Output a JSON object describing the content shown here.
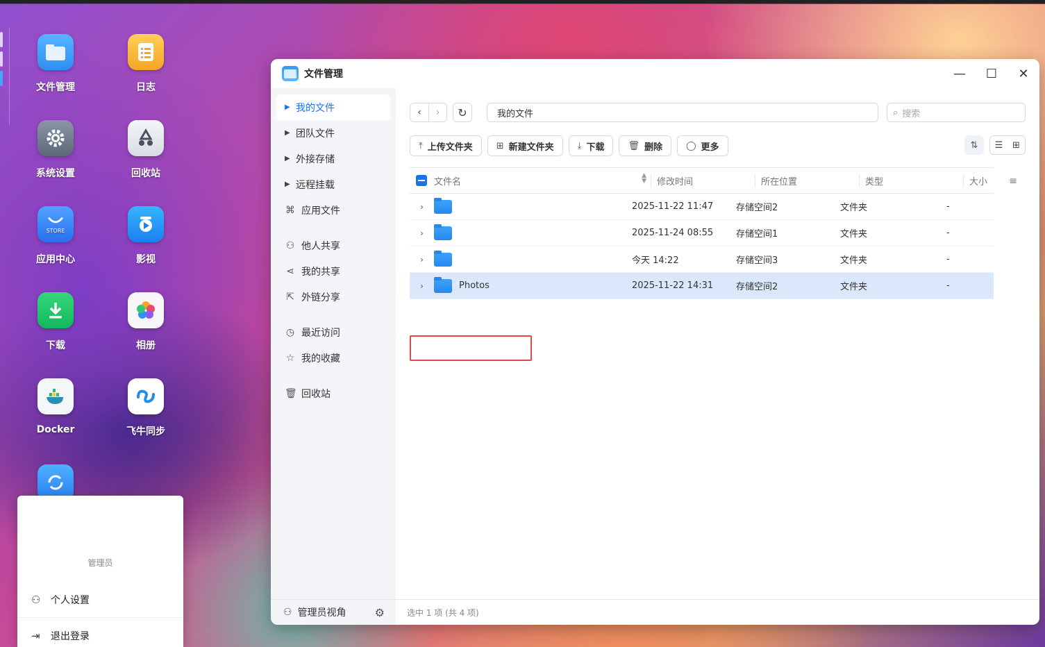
{
  "desktop": {
    "icons": [
      {
        "label": "文件管理",
        "icon": "folder-icon"
      },
      {
        "label": "日志",
        "icon": "log-icon"
      },
      {
        "label": "系统设置",
        "icon": "gear-icon"
      },
      {
        "label": "回收站",
        "icon": "recycle-bin-icon"
      },
      {
        "label": "应用中心",
        "icon": "store-icon",
        "badge": "STORE"
      },
      {
        "label": "影视",
        "icon": "video-icon"
      },
      {
        "label": "下载",
        "icon": "download-icon"
      },
      {
        "label": "相册",
        "icon": "photos-icon"
      },
      {
        "label": "Docker",
        "icon": "docker-icon"
      },
      {
        "label": "飞牛同步",
        "icon": "sync-icon"
      },
      {
        "label": "",
        "icon": "refresh-app-icon"
      }
    ]
  },
  "window": {
    "title": "文件管理",
    "controls": {
      "minimize": "—",
      "maximize": "☐",
      "close": "✕"
    }
  },
  "sidebar": {
    "items": [
      {
        "label": "我的文件",
        "active": true
      },
      {
        "label": "团队文件"
      },
      {
        "label": "外接存储"
      },
      {
        "label": "远程挂载"
      },
      {
        "label": "应用文件"
      },
      {
        "label": "他人共享"
      },
      {
        "label": "我的共享"
      },
      {
        "label": "外链分享"
      },
      {
        "label": "最近访问"
      },
      {
        "label": "我的收藏"
      },
      {
        "label": "回收站"
      }
    ],
    "admin_view": "管理员视角"
  },
  "main": {
    "path": "我的文件",
    "search_placeholder": "搜索",
    "toolbar": {
      "upload": "上传文件夹",
      "new_folder": "新建文件夹",
      "download": "下载",
      "delete": "删除",
      "more": "更多"
    },
    "columns": {
      "name": "文件名",
      "modified": "修改时间",
      "location": "所在位置",
      "type": "类型",
      "size": "大小"
    },
    "rows": [
      {
        "name": "",
        "modified": "2025-11-22 11:47",
        "location": "存储空间2",
        "type": "文件夹",
        "size": "-"
      },
      {
        "name": "",
        "modified": "2025-11-24 08:55",
        "location": "存储空间1",
        "type": "文件夹",
        "size": "-"
      },
      {
        "name": "",
        "modified": "今天 14:22",
        "location": "存储空间3",
        "type": "文件夹",
        "size": "-"
      },
      {
        "name": "Photos",
        "modified": "2025-11-22 14:31",
        "location": "存储空间2",
        "type": "文件夹",
        "size": "-",
        "selected": true
      }
    ],
    "status": "选中 1 项 (共 4 项)"
  },
  "user_menu": {
    "role": "管理员",
    "settings": "个人设置",
    "logout": "退出登录"
  },
  "colors": {
    "accent": "#1a73e8",
    "selected_row": "#dbe8fb",
    "highlight_box": "#e24a4a"
  }
}
